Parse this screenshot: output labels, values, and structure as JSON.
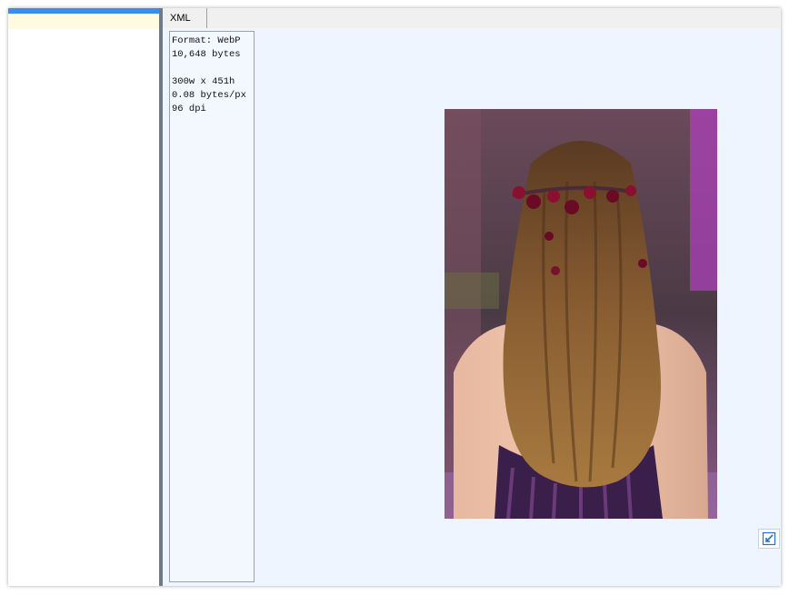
{
  "tabs": [
    {
      "label": "XML"
    }
  ],
  "image_info": {
    "format": "Format: WebP",
    "size": "10,648 bytes",
    "dimensions": "300w x 451h",
    "density": "0.08 bytes/px",
    "dpi": "96 dpi"
  },
  "colors": {
    "accent": "#3b8eea",
    "selection": "#fffbe0",
    "viewer_background": "#eef5ff"
  },
  "icons": {
    "fit_button": "resize-arrow-icon"
  }
}
